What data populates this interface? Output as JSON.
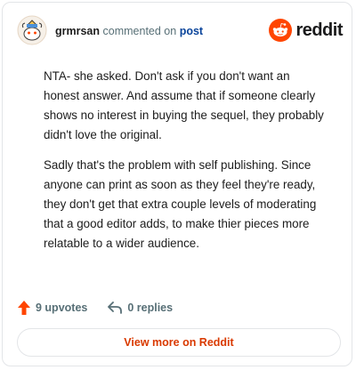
{
  "header": {
    "username": "grmrsan",
    "action_text": "commented on",
    "post_link": "post",
    "brand_name": "reddit"
  },
  "comment": {
    "paragraphs": [
      "NTA- she asked. Don't ask if you don't want an honest answer. And assume that if someone clearly shows no interest in buying the sequel, they probably didn't love the original.",
      "Sadly that's the problem with self publishing. Since anyone can print as soon as they feel they're ready, they don't get that extra couple levels of moderating that a good editor adds, to make thier pieces more relatable to a wider audience."
    ]
  },
  "footer": {
    "upvotes": "9 upvotes",
    "replies": "0 replies"
  },
  "view_button": {
    "label": "View more on Reddit"
  },
  "colors": {
    "brand_orange": "#ff4500",
    "link_blue": "#0a449b",
    "button_text": "#d93900"
  },
  "icons": {
    "avatar": "snoo-avatar",
    "brand": "reddit-logo-icon",
    "upvote": "upvote-arrow-icon",
    "reply": "reply-arrow-icon"
  }
}
